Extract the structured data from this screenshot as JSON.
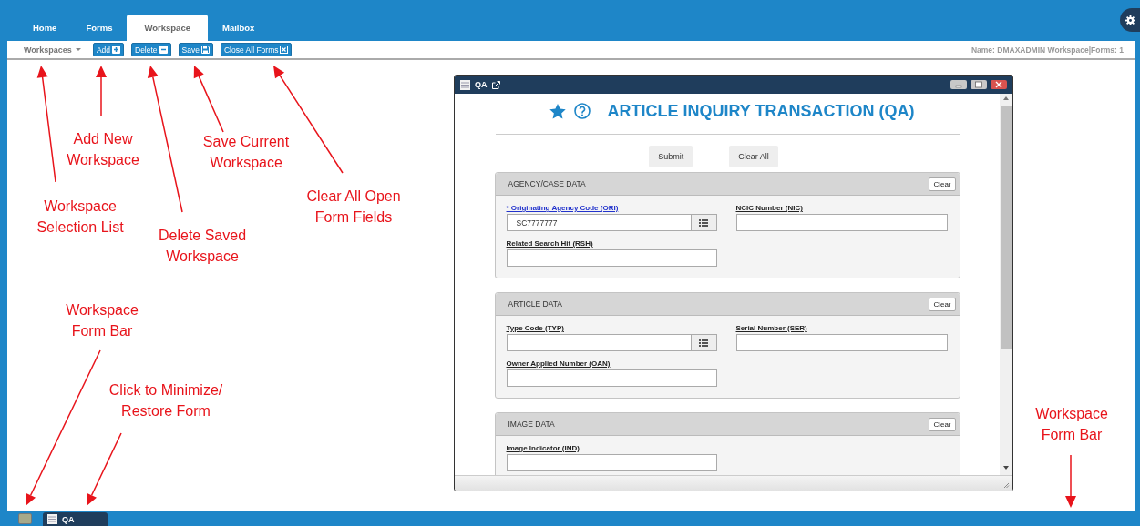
{
  "tabs": [
    {
      "label": "Home",
      "selected": false
    },
    {
      "label": "Forms",
      "selected": false
    },
    {
      "label": "Workspace",
      "selected": true
    },
    {
      "label": "Mailbox",
      "selected": false
    }
  ],
  "toolbar": {
    "dropdown": "Workspaces",
    "buttons": [
      {
        "label": "Add",
        "kind": "add"
      },
      {
        "label": "Delete",
        "kind": "delete"
      },
      {
        "label": "Save",
        "kind": "save"
      },
      {
        "label": "Close All Forms",
        "kind": "close"
      }
    ],
    "status": "Name: DMAXADMIN Workspace|Forms: 1"
  },
  "form_window": {
    "title": "QA",
    "heading": "ARTICLE INQUIRY TRANSACTION (QA)",
    "buttons": [
      "Submit",
      "Clear All"
    ],
    "sections": [
      {
        "title": "AGENCY/CASE DATA",
        "clear": "Clear",
        "fields": [
          {
            "label": "* Originating Agency Code (ORI)",
            "required": true,
            "kind": "lookup",
            "value": "SC7777777"
          },
          {
            "label": "NCIC Number (NIC)",
            "required": false,
            "kind": "text"
          },
          {
            "label": "Related Search Hit (RSH)",
            "required": false,
            "kind": "text"
          }
        ]
      },
      {
        "title": "ARTICLE DATA",
        "clear": "Clear",
        "fields": [
          {
            "label": "Type Code (TYP)",
            "required": false,
            "kind": "lookup"
          },
          {
            "label": "Serial Number (SER)",
            "required": false,
            "kind": "text"
          },
          {
            "label": "Owner Applied Number (OAN)",
            "required": false,
            "kind": "text"
          }
        ]
      },
      {
        "title": "IMAGE DATA",
        "clear": "Clear",
        "fields": [
          {
            "label": "Image Indicator (IND)",
            "required": false,
            "kind": "text"
          }
        ]
      }
    ]
  },
  "taskbar": {
    "items": [
      {
        "label": "QA"
      }
    ]
  },
  "annotations": [
    {
      "text": "Add New\nWorkspace"
    },
    {
      "text": "Save Current\nWorkspace"
    },
    {
      "text": "Workspace\nSelection List"
    },
    {
      "text": "Delete Saved\nWorkspace"
    },
    {
      "text": "Clear All Open\nForm Fields"
    },
    {
      "text": "Workspace\nForm Bar"
    },
    {
      "text": "Click to Minimize/\nRestore Form"
    },
    {
      "text": "Workspace\nForm Bar"
    }
  ]
}
